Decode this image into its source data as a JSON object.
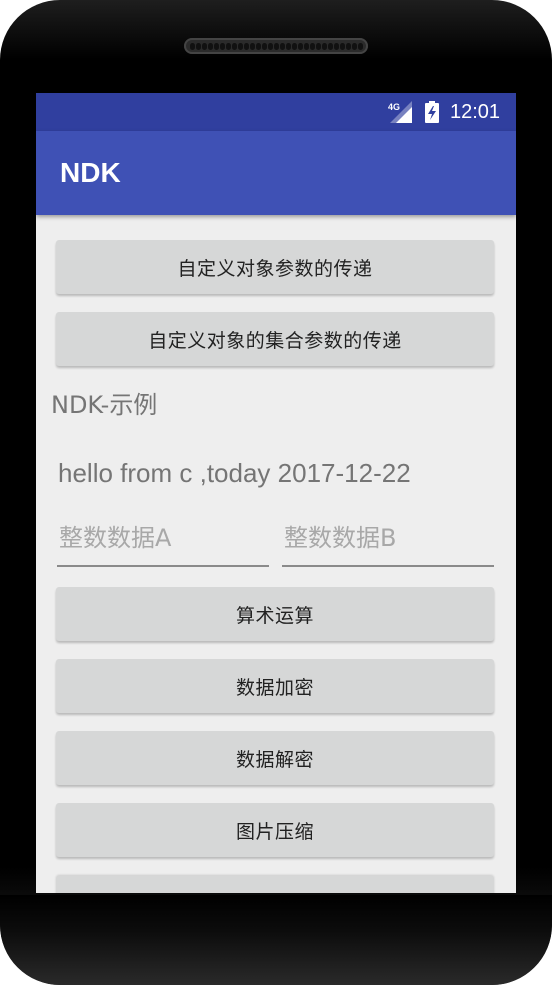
{
  "status_bar": {
    "network": "4G",
    "time": "12:01"
  },
  "app_bar": {
    "title": "NDK"
  },
  "buttons": {
    "custom_object_param": "自定义对象参数的传递",
    "custom_collection_param": "自定义对象的集合参数的传递",
    "arithmetic": "算术运算",
    "encrypt": "数据加密",
    "decrypt": "数据解密",
    "compress_image": "图片压缩"
  },
  "labels": {
    "section_title": "NDK-示例",
    "hello_text": "hello from c ,today 2017-12-22"
  },
  "inputs": {
    "a": {
      "value": "",
      "placeholder": "整数数据A"
    },
    "b": {
      "value": "",
      "placeholder": "整数数据B"
    }
  },
  "colors": {
    "status_bar": "#303f9f",
    "primary": "#3f51b5",
    "background": "#eeeeee",
    "button": "#d6d7d7"
  }
}
